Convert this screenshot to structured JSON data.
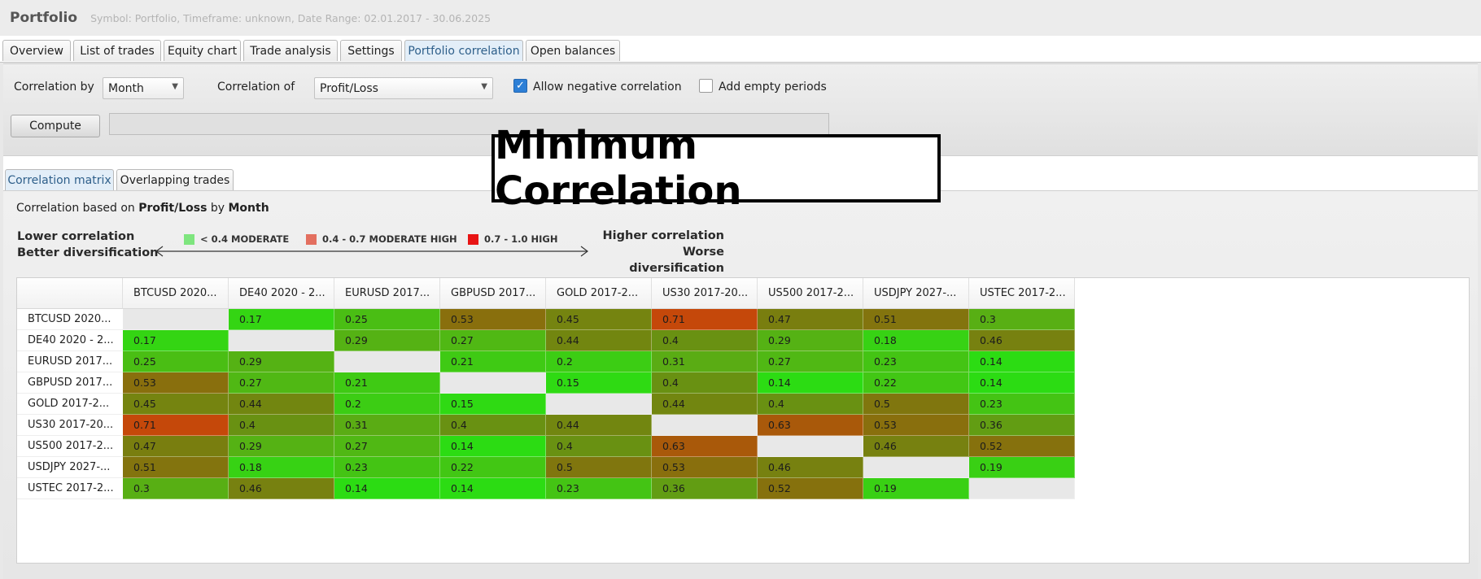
{
  "app": {
    "title": "Portfolio",
    "subtitle": "Symbol: Portfolio, Timeframe: unknown, Date Range: 02.01.2017 - 30.06.2025"
  },
  "main_tabs": [
    {
      "label": "Overview",
      "active": false
    },
    {
      "label": "List of trades",
      "active": false
    },
    {
      "label": "Equity chart",
      "active": false
    },
    {
      "label": "Trade analysis",
      "active": false
    },
    {
      "label": "Settings",
      "active": false
    },
    {
      "label": "Portfolio correlation",
      "active": true
    },
    {
      "label": "Open balances",
      "active": false
    }
  ],
  "toolbar": {
    "correlation_by_label": "Correlation by",
    "correlation_by_value": "Month",
    "correlation_of_label": "Correlation of",
    "correlation_of_value": "Profit/Loss",
    "allow_negative_label": "Allow negative correlation",
    "allow_negative_checked": true,
    "add_empty_label": "Add empty periods",
    "add_empty_checked": false,
    "compute_label": "Compute",
    "progress": 0
  },
  "overlay": {
    "text": "Minimum Correlation"
  },
  "sub_tabs": [
    {
      "label": "Correlation matrix",
      "active": true
    },
    {
      "label": "Overlapping trades",
      "active": false
    }
  ],
  "panel": {
    "based_prefix": "Correlation based on",
    "based_measure": "Profit/Loss",
    "based_mid": "by",
    "based_period": "Month"
  },
  "legend": {
    "lower_line1": "Lower correlation",
    "lower_line2": "Better diversification",
    "higher_line1": "Higher correlation",
    "higher_line2": "Worse diversification",
    "items": [
      {
        "label": "< 0.4 MODERATE",
        "color": "#7ee57e"
      },
      {
        "label": "0.4 - 0.7 MODERATE HIGH",
        "color": "#e36f5f"
      },
      {
        "label": "0.7 - 1.0 HIGH",
        "color": "#e81414"
      }
    ]
  },
  "matrix": {
    "labels": [
      "BTCUSD 2020...",
      "DE40 2020 - 2...",
      "EURUSD 2017...",
      "GBPUSD 2017...",
      "GOLD 2017-2...",
      "US30 2017-20...",
      "US500 2017-2...",
      "USDJPY 2027-...",
      "USTEC 2017-2..."
    ],
    "values": [
      [
        null,
        0.17,
        0.25,
        0.53,
        0.45,
        0.71,
        0.47,
        0.51,
        0.3
      ],
      [
        0.17,
        null,
        0.29,
        0.27,
        0.44,
        0.4,
        0.29,
        0.18,
        0.46
      ],
      [
        0.25,
        0.29,
        null,
        0.21,
        0.2,
        0.31,
        0.27,
        0.23,
        0.14
      ],
      [
        0.53,
        0.27,
        0.21,
        null,
        0.15,
        0.4,
        0.14,
        0.22,
        0.14
      ],
      [
        0.45,
        0.44,
        0.2,
        0.15,
        null,
        0.44,
        0.4,
        0.5,
        0.23
      ],
      [
        0.71,
        0.4,
        0.31,
        0.4,
        0.44,
        null,
        0.63,
        0.53,
        0.36
      ],
      [
        0.47,
        0.29,
        0.27,
        0.14,
        0.4,
        0.63,
        null,
        0.46,
        0.52
      ],
      [
        0.51,
        0.18,
        0.23,
        0.22,
        0.5,
        0.53,
        0.46,
        null,
        0.19
      ],
      [
        0.3,
        0.46,
        0.14,
        0.14,
        0.23,
        0.36,
        0.52,
        0.19,
        null
      ]
    ]
  }
}
